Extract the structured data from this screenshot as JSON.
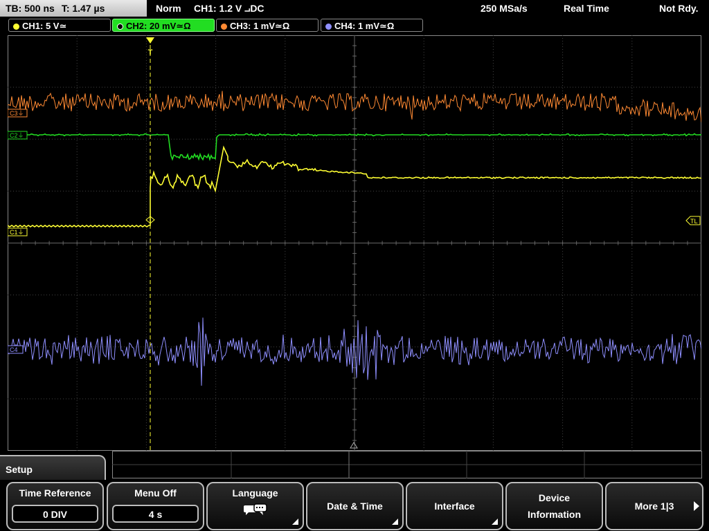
{
  "status": {
    "timebase": "TB: 500 ns",
    "trigger_time": "T: 1.47 µs",
    "mode": "Norm",
    "trigger": "CH1: 1.2 V ⨼DC",
    "sample_rate": "250 MSa/s",
    "acq_mode": "Real Time",
    "state": "Not Rdy."
  },
  "channels": [
    {
      "label": "CH1: 5 V≃",
      "color": "#ffff33"
    },
    {
      "label": "CH2: 20 mV≃Ω",
      "color": "#22dd22"
    },
    {
      "label": "CH3: 1 mV≃Ω",
      "color": "#ff8a33"
    },
    {
      "label": "CH4: 1 mV≃Ω",
      "color": "#8f8fff"
    }
  ],
  "markers": {
    "c3": "C3⏚",
    "c2": "C2⏚",
    "c1": "C1⏚",
    "c4": "C4",
    "tl": "TL",
    "trigger_pos": "T"
  },
  "menu": {
    "title": "Setup",
    "time_reference": {
      "label": "Time Reference",
      "value": "0 DIV"
    },
    "menu_off": {
      "label": "Menu Off",
      "value": "4 s"
    },
    "language": {
      "label": "Language"
    },
    "date_time": {
      "label": "Date & Time"
    },
    "interface": {
      "label": "Interface"
    },
    "device_info": {
      "label1": "Device",
      "label2": "Information"
    },
    "more": {
      "label": "More 1|3"
    }
  },
  "colors": {
    "ch1": "#ffff33",
    "ch2": "#22dd22",
    "ch3": "#ff8a33",
    "ch4": "#8f8fff",
    "grid": "#555555",
    "accent": "#22dd22"
  }
}
